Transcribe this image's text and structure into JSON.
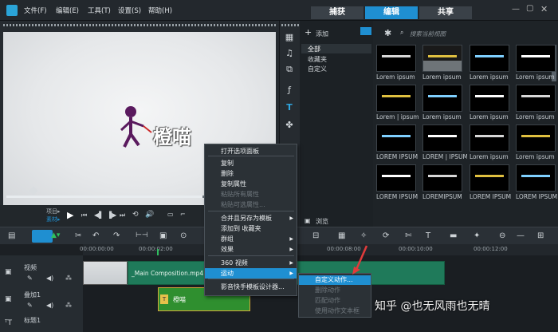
{
  "menubar": {
    "items": [
      "文件(F)",
      "编辑(E)",
      "工具(T)",
      "设置(S)",
      "帮助(H)"
    ],
    "tabs": [
      "捕获",
      "编辑",
      "共享"
    ],
    "active_tab": "编辑"
  },
  "preview": {
    "title_text": "橙喵",
    "mode_labels": [
      "项目▸",
      "素材▸"
    ]
  },
  "library": {
    "add_label": "添加",
    "folders": [
      "全部",
      "收藏夹",
      "自定义"
    ],
    "browse_label": "浏览",
    "search_placeholder": "搜索当前视图"
  },
  "thumbnails": {
    "rows": [
      [
        "Lorem ipsum",
        "Lorem ipsum",
        "Lorem ipsum",
        "Lorem ipsum"
      ],
      [
        "Lorem | ipsum",
        "Lorem ipsum",
        "Lorem ipsum",
        "Lorem ipsum"
      ],
      [
        "LOREM IPSUM",
        "LOREM | IPSUM",
        "Lorem ipsum",
        "Lorem ipsum"
      ],
      [
        "LOREM IPSUM",
        "LOREMIPSUM",
        "LOREM IPSUM",
        "LOREM IPSUM"
      ]
    ]
  },
  "timeline": {
    "ruler": [
      "00:00:00:00",
      "00:00:02:00",
      "00:00:08:00",
      "00:00:10:00",
      "00:00:12:00"
    ],
    "tracks": [
      "视频",
      "叠加1",
      "标题1"
    ],
    "video_clip": "_Main Composition.mp4",
    "overlay_clip": "橙喵"
  },
  "context_menu": {
    "items": [
      {
        "label": "打开选项面板",
        "state": "normal"
      },
      {
        "label": "复制",
        "state": "normal"
      },
      {
        "label": "删除",
        "state": "normal"
      },
      {
        "label": "复制属性",
        "state": "normal"
      },
      {
        "label": "粘贴所有属性",
        "state": "disabled"
      },
      {
        "label": "粘贴可选属性...",
        "state": "disabled"
      },
      {
        "label": "合并且另存为模板",
        "state": "submenu"
      },
      {
        "label": "添加到 收藏夹",
        "state": "normal"
      },
      {
        "label": "群组",
        "state": "submenu"
      },
      {
        "label": "效果",
        "state": "submenu"
      },
      {
        "label": "360 视频",
        "state": "submenu"
      },
      {
        "label": "运动",
        "state": "selected"
      },
      {
        "label": "影音快手模板设计器...",
        "state": "normal"
      }
    ]
  },
  "submenu": {
    "items": [
      {
        "label": "自定义动作...",
        "state": "selected"
      },
      {
        "label": "删除动作",
        "state": "disabled"
      },
      {
        "label": "匹配动作",
        "state": "disabled"
      },
      {
        "label": "使用动作文本框",
        "state": "disabled"
      }
    ]
  },
  "watermark": "知乎 @也无风雨也无晴",
  "colors": {
    "accent": "#1f8fd1",
    "clip_green": "#1f7a5a",
    "overlay_green": "#2f8f2f"
  }
}
